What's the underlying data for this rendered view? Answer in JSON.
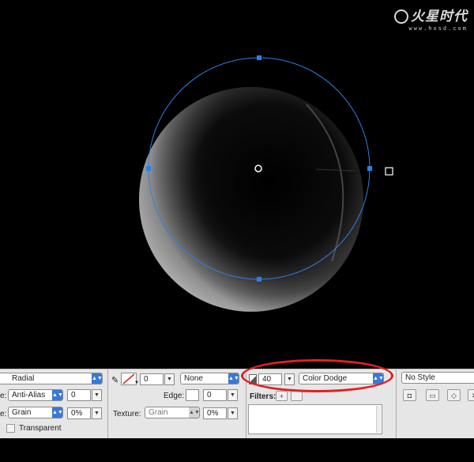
{
  "watermark": {
    "brand": "火星时代",
    "url": "www.hxsd.com"
  },
  "toolbar": {
    "fill_type": "Radial",
    "edge_label": "e:",
    "edge_mode": "Anti-Alias",
    "edge_value": "0",
    "texture_label_left": "e:",
    "texture_left": "Grain",
    "texture_left_pct": "0%",
    "transparent_label": "Transparent",
    "stroke_size": "0",
    "stroke_type": "None",
    "stroke_edge_label": "Edge:",
    "stroke_edge_value": "0",
    "stroke_texture_label": "Texture:",
    "stroke_texture": "Grain",
    "stroke_texture_pct": "0%",
    "opacity_value": "40",
    "blend_mode": "Color Dodge",
    "filters_label": "Filters:",
    "filters_add": "+",
    "style_value": "No Style"
  },
  "colors": {
    "accent": "#3a78d8",
    "selection_path": "#2f7fe6",
    "highlight_oval": "#e31e24",
    "canvas": "#000000"
  },
  "icons": [
    "pencil-icon",
    "no-stroke-swatch-icon",
    "opacity-icon",
    "filter-add-icon",
    "new-style-icon",
    "redefine-style-icon",
    "break-link-icon",
    "delete-style-icon"
  ]
}
